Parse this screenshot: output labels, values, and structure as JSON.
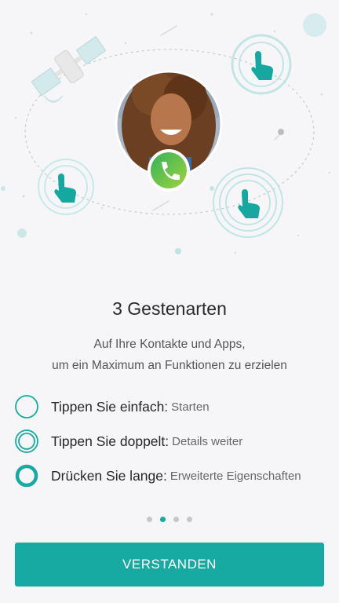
{
  "onboarding": {
    "title": "3 Gestenarten",
    "subtitle_line1": "Auf Ihre Kontakte und Apps,",
    "subtitle_line2": "um ein Maximum an Funktionen zu erzielen",
    "gestures": [
      {
        "label": "Tippen Sie einfach:",
        "desc": "Starten",
        "icon": "single-ring"
      },
      {
        "label": "Tippen Sie doppelt:",
        "desc": "Details weiter",
        "icon": "double-ring"
      },
      {
        "label": "Drücken Sie lange:",
        "desc": "Erweiterte Eigenschaften",
        "icon": "thick-ring"
      }
    ],
    "page_indicator": {
      "total": 4,
      "current": 2
    },
    "button_label": "VERSTANDEN"
  },
  "colors": {
    "accent": "#17aaa2",
    "background": "#f6f6f8",
    "call_badge": "#34b34a"
  },
  "icons": [
    "satellite-icon",
    "tap-hand-icon",
    "phone-icon",
    "contact-avatar"
  ]
}
